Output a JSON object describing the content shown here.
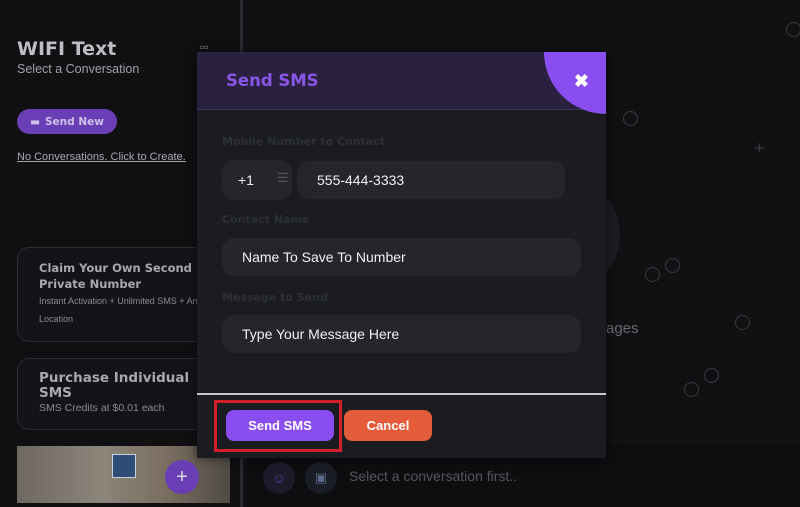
{
  "sidebar": {
    "title": "WIFI Text",
    "subtitle": "Select a Conversation",
    "send_new_label": "Send New",
    "no_conversations_link": "No Conversations. Click to Create.",
    "cards": [
      {
        "title": "Claim Your Own Second Private Number",
        "desc": "Instant Activation + Unlimited SMS + Any Location"
      },
      {
        "title": "Purchase Individual SMS",
        "desc": "SMS Credits at $0.01 each"
      }
    ]
  },
  "main": {
    "empty_text_fragment": "ages",
    "composer_placeholder": "Select a conversation first.."
  },
  "modal": {
    "title": "Send SMS",
    "mobile_label": "Mobile Number to Contact",
    "country_code": "+1",
    "phone_value": "555-444-3333",
    "contact_label": "Contact Name",
    "contact_placeholder": "Name To Save To Number",
    "message_label": "Message to Send",
    "message_placeholder": "Type Your Message Here",
    "send_button": "Send SMS",
    "cancel_button": "Cancel"
  },
  "colors": {
    "accent": "#8a4df0",
    "cancel": "#e45c3a",
    "highlight": "#d21f2a"
  }
}
